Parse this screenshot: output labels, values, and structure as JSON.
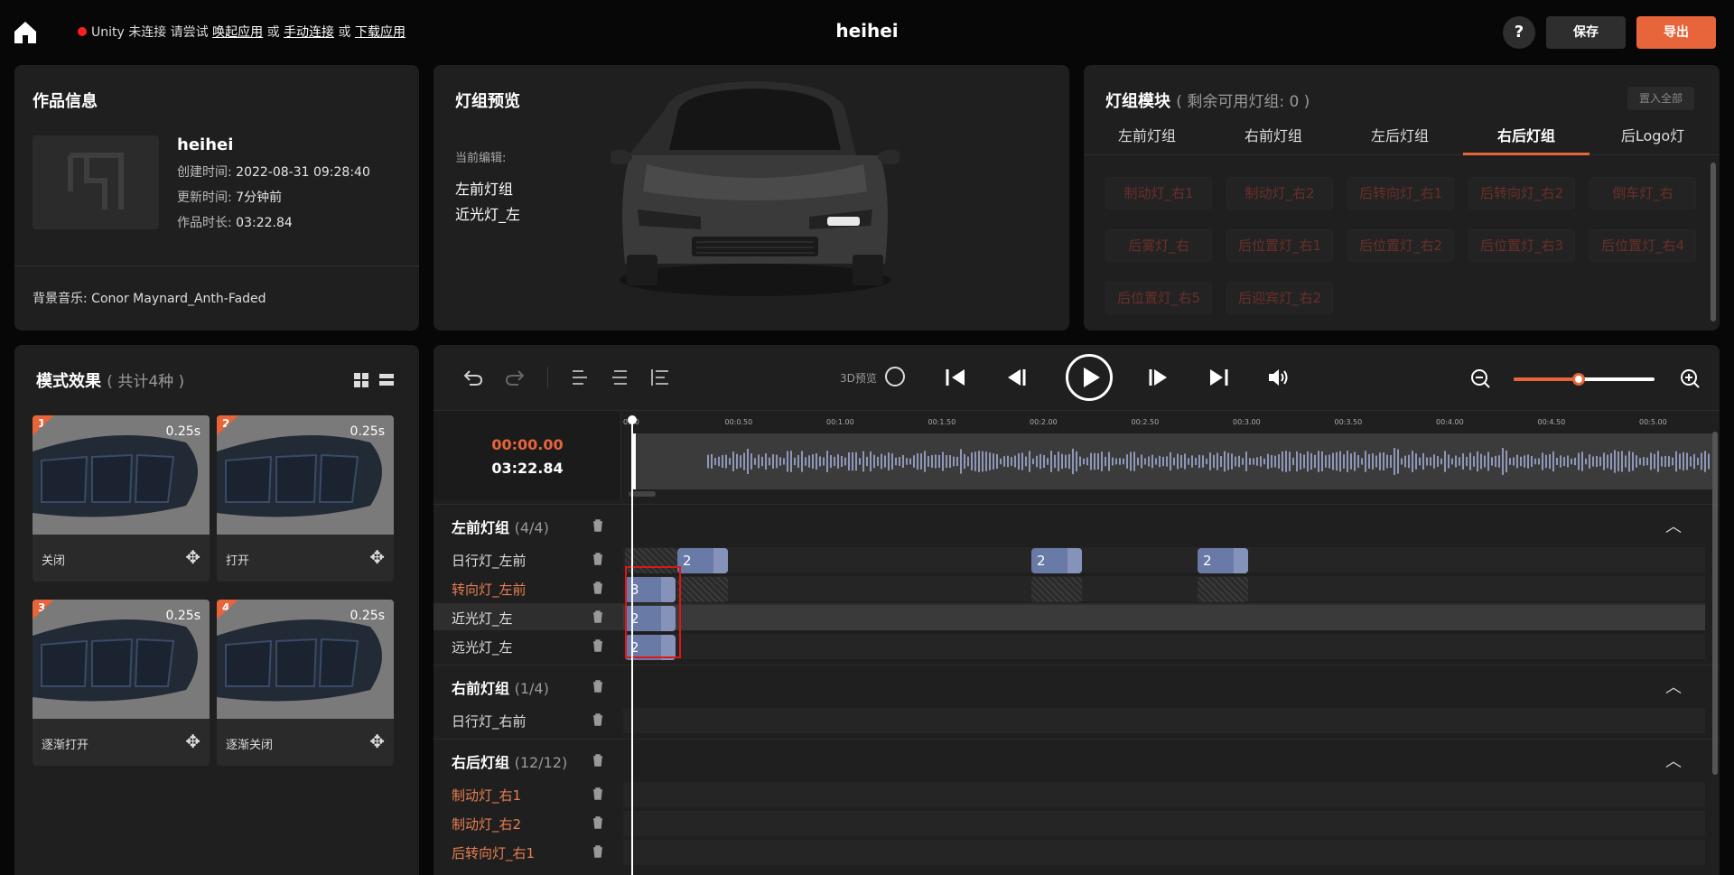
{
  "topbar": {
    "title": "heihei",
    "unity_status": {
      "prefix": "Unity 未连接 请尝试 ",
      "link_launch": "唤起应用",
      "or1": " 或 ",
      "link_connect": "手动连接",
      "or2": " 或 ",
      "link_download": "下载应用"
    },
    "help_label": "?",
    "save_label": "保存",
    "export_label": "导出"
  },
  "work_info": {
    "title": "作品信息",
    "name": "heihei",
    "created_label": "创建时间:",
    "created_value": "2022-08-31 09:28:40",
    "updated_label": "更新时间:",
    "updated_value": "7分钟前",
    "duration_label": "作品时长:",
    "duration_value": "03:22.84",
    "music_label": "背景音乐:",
    "music_value": "Conor Maynard_Anth-Faded"
  },
  "preview": {
    "title": "灯组预览",
    "current_edit_label": "当前编辑:",
    "current_group": "左前灯组",
    "current_light": "近光灯_左"
  },
  "modules": {
    "title": "灯组模块",
    "subtitle": "( 剩余可用灯组: 0 )",
    "add_all_label": "置入全部",
    "tabs": [
      {
        "label": "左前灯组"
      },
      {
        "label": "右前灯组"
      },
      {
        "label": "左后灯组"
      },
      {
        "label": "右后灯组"
      },
      {
        "label": "后Logo灯"
      }
    ],
    "chips": [
      "制动灯_右1",
      "制动灯_右2",
      "后转向灯_右1",
      "后转向灯_右2",
      "倒车灯_右",
      "后雾灯_右",
      "后位置灯_右1",
      "后位置灯_右2",
      "后位置灯_右3",
      "后位置灯_右4",
      "后位置灯_右5",
      "后迎宾灯_右2"
    ]
  },
  "effects": {
    "title": "模式效果",
    "subtitle": "( 共计4种 )",
    "items": [
      {
        "index": "1",
        "duration": "0.25s",
        "name": "关闭"
      },
      {
        "index": "2",
        "duration": "0.25s",
        "name": "打开"
      },
      {
        "index": "3",
        "duration": "0.25s",
        "name": "逐渐打开"
      },
      {
        "index": "4",
        "duration": "0.25s",
        "name": "逐渐关闭"
      }
    ]
  },
  "timeline": {
    "preview3d_label": "3D预览",
    "current_time": "00:00.00",
    "total_time": "03:22.84",
    "ticks": [
      "0.00",
      "00:0.50",
      "00:1.00",
      "00:1.50",
      "00:2.00",
      "00:2.50",
      "00:3.00",
      "00:3.50",
      "00:4.00",
      "00:4.50",
      "00:5.00"
    ],
    "zoom_level": 0.46,
    "groups": [
      {
        "name": "左前灯组",
        "count": "(4/4)"
      },
      {
        "name": "右前灯组",
        "count": "(1/4)"
      },
      {
        "name": "右后灯组",
        "count": "(12/12)"
      }
    ],
    "tracks": [
      {
        "name": "日行灯_左前",
        "blocks": [
          "2",
          "2",
          "2"
        ]
      },
      {
        "name": "转向灯_左前",
        "blocks": [
          "3"
        ]
      },
      {
        "name": "近光灯_左",
        "blocks": [
          "2"
        ]
      },
      {
        "name": "远光灯_左",
        "blocks": [
          "2"
        ]
      },
      {
        "name": "日行灯_右前",
        "blocks": []
      },
      {
        "name": "制动灯_右1",
        "blocks": []
      },
      {
        "name": "制动灯_右2",
        "blocks": []
      },
      {
        "name": "后转向灯_右1",
        "blocks": []
      }
    ]
  },
  "colors": {
    "accent": "#e8643a",
    "block": "#6a7aa6",
    "panel": "#1f1f1f",
    "warn_text": "#e87e52",
    "highlight": "#e01515"
  },
  "icons": [
    "home-icon",
    "help-icon",
    "undo-icon",
    "redo-icon",
    "align-left-icon",
    "align-center-icon",
    "align-start-icon",
    "skip-start-icon",
    "step-back-icon",
    "play-icon",
    "step-forward-icon",
    "skip-end-icon",
    "volume-icon",
    "zoom-out-icon",
    "zoom-in-icon",
    "trash-icon",
    "chevron-up-icon",
    "move-icon"
  ]
}
